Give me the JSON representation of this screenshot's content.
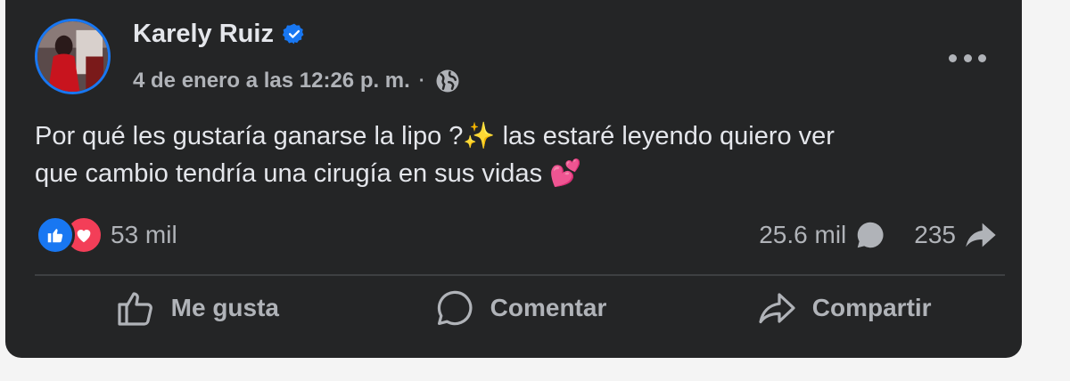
{
  "post": {
    "author": "Karely Ruiz",
    "verified_icon": "verified-badge-icon",
    "timestamp": "4 de enero a las 12:26 p. m.",
    "separator": "·",
    "privacy_icon": "globe-icon",
    "text_line1": "Por qué les gustaría ganarse la lipo ?✨ las estaré leyendo quiero ver",
    "text_line2": "que cambio tendría una cirugía en sus vidas 💕"
  },
  "stats": {
    "reactions_count": "53 mil",
    "comments_count": "25.6 mil",
    "shares_count": "235"
  },
  "actions": {
    "like_label": "Me gusta",
    "comment_label": "Comentar",
    "share_label": "Compartir"
  },
  "colors": {
    "card_bg": "#242526",
    "text_primary": "#e4e6eb",
    "text_secondary": "#b0b3b8",
    "accent": "#1877f2",
    "love": "#f33e58"
  }
}
